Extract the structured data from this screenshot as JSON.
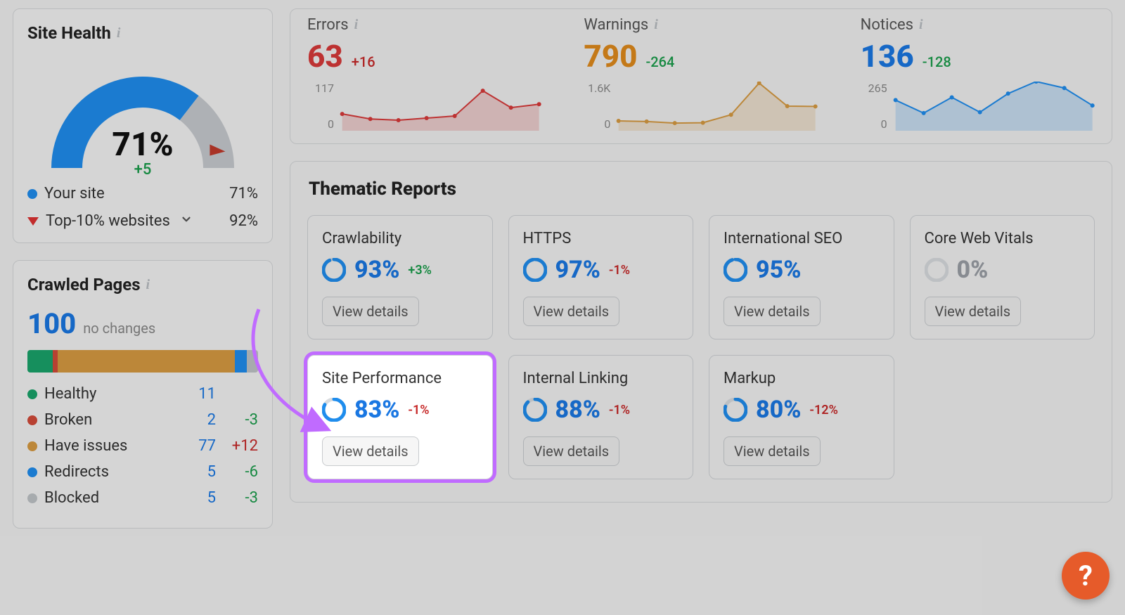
{
  "siteHealth": {
    "title": "Site Health",
    "value": "71%",
    "delta": "+5",
    "yourSite": {
      "label": "Your site",
      "value": "71%",
      "color": "#1f8ded"
    },
    "top10": {
      "label": "Top-10% websites",
      "value": "92%"
    },
    "gaugePct": 71
  },
  "crawledPages": {
    "title": "Crawled Pages",
    "count": "100",
    "sub": "no changes",
    "segments": [
      {
        "key": "healthy",
        "label": "Healthy",
        "n": "11",
        "delta": "",
        "color": "#1aa36a",
        "pct": 11
      },
      {
        "key": "broken",
        "label": "Broken",
        "n": "2",
        "delta": "-3",
        "color": "#d24b3a",
        "pct": 2
      },
      {
        "key": "haveissues",
        "label": "Have issues",
        "n": "77",
        "delta": "+12",
        "color": "#d69a41",
        "pct": 77
      },
      {
        "key": "redirects",
        "label": "Redirects",
        "n": "5",
        "delta": "-6",
        "color": "#1f8ded",
        "pct": 5
      },
      {
        "key": "blocked",
        "label": "Blocked",
        "n": "5",
        "delta": "-3",
        "color": "#bfc3c7",
        "pct": 5
      }
    ]
  },
  "metrics": {
    "errors": {
      "label": "Errors",
      "value": "63",
      "delta": "+16",
      "deltaClass": "pos",
      "ymax": "117",
      "color": "#d83a3a"
    },
    "warnings": {
      "label": "Warnings",
      "value": "790",
      "delta": "-264",
      "deltaClass": "neg",
      "ymax": "1.6K",
      "color": "#d69a41"
    },
    "notices": {
      "label": "Notices",
      "value": "136",
      "delta": "-128",
      "deltaClass": "neg",
      "ymax": "265",
      "color": "#1f8ded"
    }
  },
  "thematic": {
    "title": "Thematic Reports",
    "viewDetails": "View details",
    "cards": [
      {
        "key": "crawlability",
        "title": "Crawlability",
        "pct": "93%",
        "p": 93,
        "delta": "+3%",
        "deltaClass": "pos"
      },
      {
        "key": "https",
        "title": "HTTPS",
        "pct": "97%",
        "p": 97,
        "delta": "-1%",
        "deltaClass": "neg"
      },
      {
        "key": "intl-seo",
        "title": "International SEO",
        "pct": "95%",
        "p": 95,
        "delta": "",
        "deltaClass": ""
      },
      {
        "key": "core-web-vitals",
        "title": "Core Web Vitals",
        "pct": "0%",
        "p": 0,
        "delta": "",
        "deltaClass": "",
        "zero": true
      },
      {
        "key": "site-performance",
        "title": "Site Performance",
        "pct": "83%",
        "p": 83,
        "delta": "-1%",
        "deltaClass": "neg",
        "highlight": true
      },
      {
        "key": "internal-linking",
        "title": "Internal Linking",
        "pct": "88%",
        "p": 88,
        "delta": "-1%",
        "deltaClass": "neg"
      },
      {
        "key": "markup",
        "title": "Markup",
        "pct": "80%",
        "p": 80,
        "delta": "-12%",
        "deltaClass": "neg"
      }
    ]
  },
  "chart_data": [
    {
      "type": "line",
      "title": "Errors",
      "ylim": [
        0,
        117
      ],
      "x": [
        1,
        2,
        3,
        4,
        5,
        6,
        7,
        8
      ],
      "values": [
        40,
        28,
        25,
        30,
        35,
        95,
        55,
        63
      ]
    },
    {
      "type": "line",
      "title": "Warnings",
      "ylim": [
        0,
        1600
      ],
      "x": [
        1,
        2,
        3,
        4,
        5,
        6,
        7,
        8
      ],
      "values": [
        320,
        300,
        250,
        260,
        520,
        1550,
        800,
        790
      ]
    },
    {
      "type": "line",
      "title": "Notices",
      "ylim": [
        0,
        265
      ],
      "x": [
        1,
        2,
        3,
        4,
        5,
        6,
        7,
        8
      ],
      "values": [
        165,
        95,
        180,
        100,
        200,
        265,
        230,
        136
      ]
    }
  ],
  "zeroLabel": "0"
}
